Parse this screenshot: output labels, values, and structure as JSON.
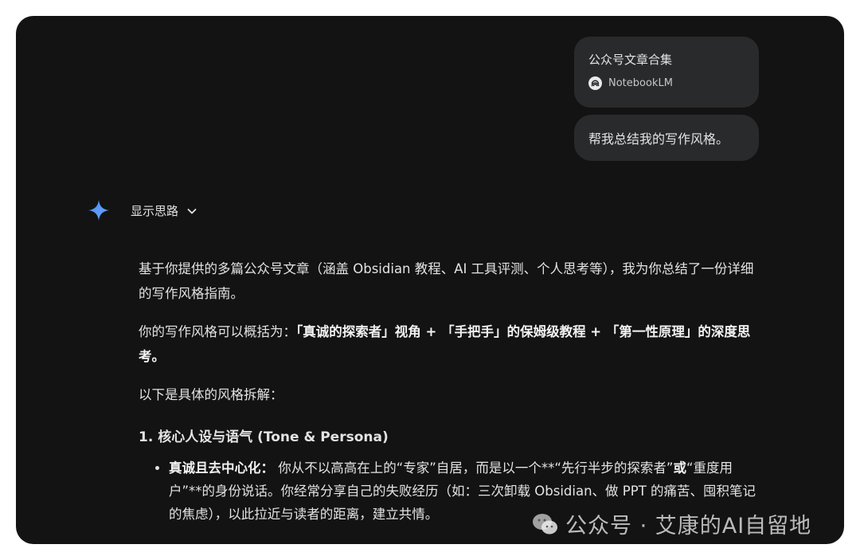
{
  "attachment": {
    "title": "公众号文章合集",
    "source": "NotebookLM"
  },
  "user_message": "帮我总结我的写作风格。",
  "thoughts": {
    "label": "显示思路",
    "icon": "chevron-down-icon"
  },
  "response": {
    "p1": "基于你提供的多篇公众号文章（涵盖 Obsidian 教程、AI 工具评测、个人思考等），我为你总结了一份详细的写作风格指南。",
    "p2_prefix": "你的写作风格可以概括为：",
    "p2_bold": "「真诚的探索者」视角 + 「手把手」的保姆级教程 + 「第一性原理」的深度思考。",
    "p3": "以下是具体的风格拆解：",
    "section1_title": "1. 核心人设与语气 (Tone & Persona)",
    "bullet1_title": "真诚且去中心化：",
    "bullet1_text_a": " 你从不以高高在上的“专家”自居，而是以一个**“先行半步的探索者”",
    "bullet1_text_b": "或",
    "bullet1_text_c": "“重度用户”**的身份说话。你经常分享自己的失败经历（如：三次卸载 Obsidian、做 PPT 的痛苦、囤积笔记的焦虑），以此拉近与读者的距离，建立共情。"
  },
  "watermark": "公众号 · 艾康的AI自留地",
  "colors": {
    "background": "#131314",
    "bubble": "#282a2c",
    "text": "#e3e3e3",
    "spark_blue": "#4c8df6"
  }
}
